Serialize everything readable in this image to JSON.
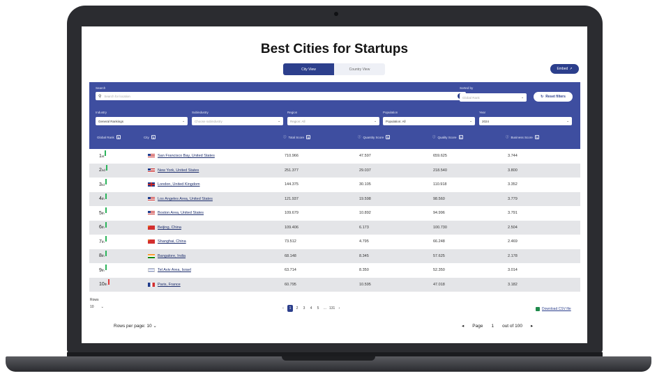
{
  "page_title": "Best Cities for Startups",
  "view_tabs": {
    "city": "City View",
    "country": "Country View"
  },
  "embed_label": "Embed",
  "filters": {
    "search_label": "Search",
    "search_placeholder": "Search for location",
    "sorted_by_label": "Sorted by",
    "sorted_by_placeholder": "Global Rank",
    "reset_label": "Reset filters",
    "industry_label": "Industry",
    "industry_value": "General Rankings",
    "subindustry_label": "Subindustry",
    "subindustry_placeholder": "Choose subindustry",
    "region_label": "Region",
    "region_value": "Region: All",
    "population_label": "Population",
    "population_value": "Population: All",
    "year_label": "Year",
    "year_value": "2024"
  },
  "columns": {
    "rank": "Global Rank",
    "city": "City",
    "total": "Total Score",
    "quantity": "Quantity Score",
    "quality": "Quality Score",
    "business": "Business Score"
  },
  "rows": [
    {
      "rank": "1",
      "suffix": "st",
      "trend": "up",
      "flag": "us",
      "city": "San Francisco Bay, United States",
      "total": "710.966",
      "quantity": "47.597",
      "quality": "659.625",
      "business": "3.744"
    },
    {
      "rank": "2",
      "suffix": "nd",
      "trend": "up",
      "flag": "us",
      "city": "New York, United States",
      "total": "251.377",
      "quantity": "29.037",
      "quality": "218.540",
      "business": "3.800"
    },
    {
      "rank": "3",
      "suffix": "rd",
      "trend": "up",
      "flag": "gb",
      "city": "London, United Kingdom",
      "total": "144.375",
      "quantity": "30.105",
      "quality": "110.918",
      "business": "3.352"
    },
    {
      "rank": "4",
      "suffix": "th",
      "trend": "up",
      "flag": "us",
      "city": "Los Angeles Area, United States",
      "total": "121.937",
      "quantity": "19.598",
      "quality": "98.560",
      "business": "3.779"
    },
    {
      "rank": "5",
      "suffix": "th",
      "trend": "up",
      "flag": "us",
      "city": "Boston Area, United States",
      "total": "109.679",
      "quantity": "10.892",
      "quality": "94.996",
      "business": "3.791"
    },
    {
      "rank": "6",
      "suffix": "th",
      "trend": "up",
      "flag": "cn",
      "city": "Beijing, China",
      "total": "109.406",
      "quantity": "6.173",
      "quality": "100.730",
      "business": "2.504"
    },
    {
      "rank": "7",
      "suffix": "th",
      "trend": "up",
      "flag": "cn",
      "city": "Shanghai, China",
      "total": "73.512",
      "quantity": "4.795",
      "quality": "66.248",
      "business": "2.469"
    },
    {
      "rank": "8",
      "suffix": "th",
      "trend": "up",
      "flag": "in",
      "city": "Bangalore, India",
      "total": "68.148",
      "quantity": "8.345",
      "quality": "57.625",
      "business": "2.178"
    },
    {
      "rank": "9",
      "suffix": "th",
      "trend": "up",
      "flag": "il",
      "city": "Tel Aviv Area, Israel",
      "total": "63.714",
      "quantity": "8.350",
      "quality": "52.350",
      "business": "3.014"
    },
    {
      "rank": "10",
      "suffix": "th",
      "trend": "down",
      "flag": "fr",
      "city": "Paris, France",
      "total": "60.795",
      "quantity": "10.595",
      "quality": "47.018",
      "business": "3.182"
    }
  ],
  "rows_label": "Rows",
  "rows_value": "10",
  "pagination": [
    "1",
    "2",
    "3",
    "4",
    "5",
    "...",
    "131"
  ],
  "csv_label": "Download CSV file",
  "rows_per_page": "Rows per page: 10",
  "page_label": "Page",
  "page_value": "1",
  "page_total": "out of 100",
  "colors": {
    "primary": "#2c3f8c",
    "panel": "#3e4ea0",
    "up": "#2bb35a",
    "down": "#e03a3a"
  }
}
